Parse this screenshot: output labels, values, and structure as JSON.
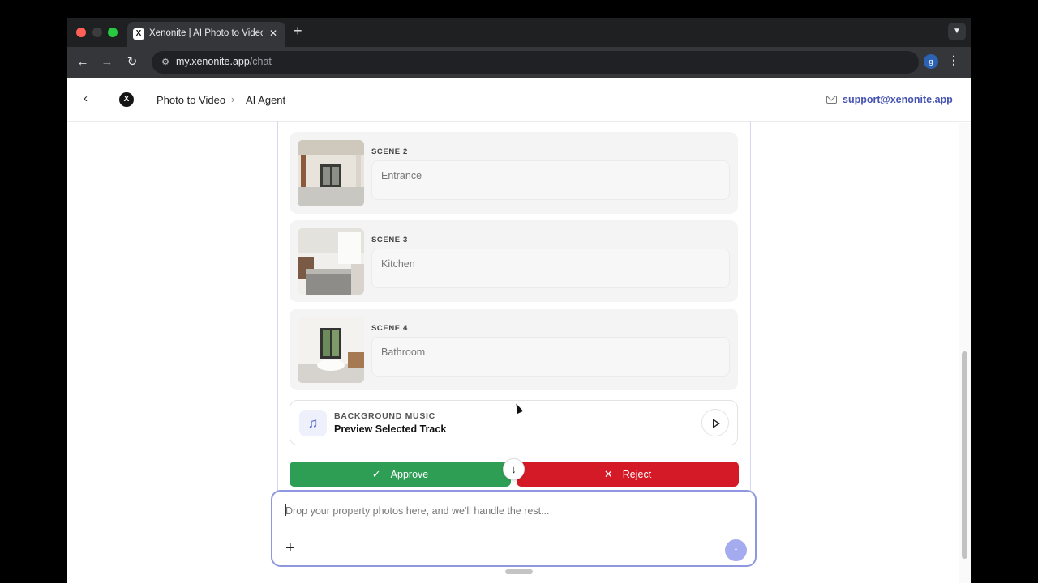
{
  "browser": {
    "tab_title": "Xenonite | AI Photo to Video S",
    "tab_favicon_letter": "X",
    "url_host": "my.xenonite.app",
    "url_path": "/chat",
    "profile_initial": "g"
  },
  "header": {
    "breadcrumb": [
      "Photo to Video",
      "AI Agent"
    ],
    "support_email": "support@xenonite.app",
    "logo_letter": "X"
  },
  "scenes": [
    {
      "label": "SCENE 2",
      "value": "Entrance"
    },
    {
      "label": "SCENE 3",
      "value": "Kitchen"
    },
    {
      "label": "SCENE 4",
      "value": "Bathroom"
    }
  ],
  "music": {
    "kicker": "BACKGROUND MUSIC",
    "title": "Preview Selected Track"
  },
  "actions": {
    "approve_label": "Approve",
    "reject_label": "Reject"
  },
  "composer": {
    "placeholder": "Drop your property photos here, and we'll handle the rest..."
  },
  "colors": {
    "approve": "#2f9e55",
    "reject": "#d51a27",
    "accent": "#4653b0"
  }
}
